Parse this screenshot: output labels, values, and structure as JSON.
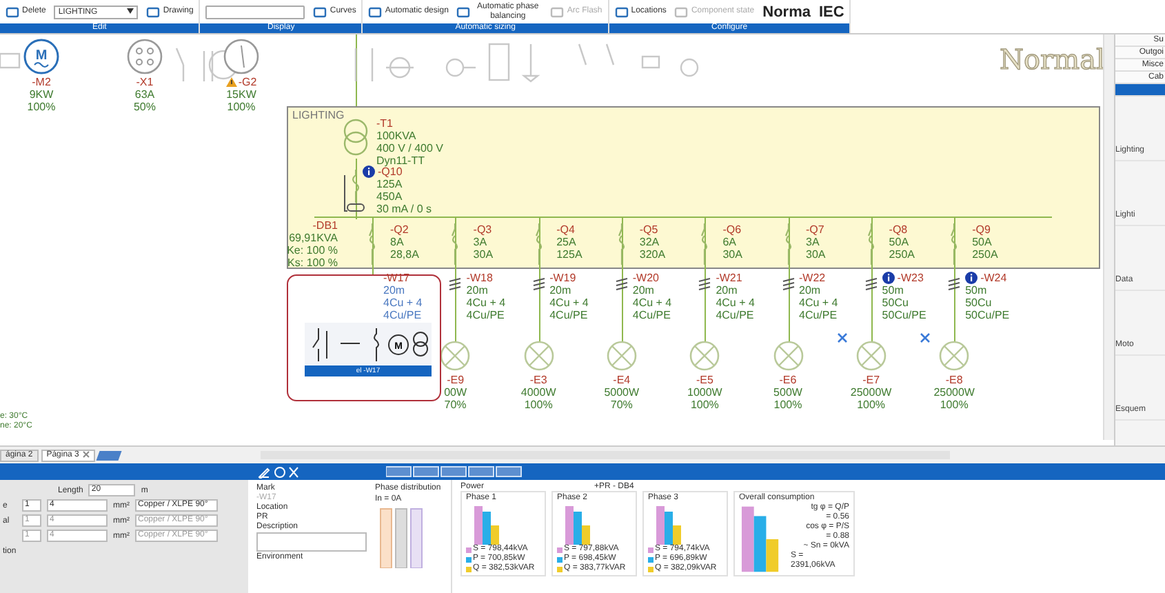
{
  "ribbon": {
    "groups": [
      {
        "label": "Edit",
        "items": [
          {
            "kind": "button",
            "label": "Delete",
            "disabled": false
          },
          {
            "kind": "dropdown",
            "value": "LIGHTING"
          },
          {
            "kind": "button",
            "label": "Drawing",
            "disabled": false
          }
        ]
      },
      {
        "label": "Display",
        "items": [
          {
            "kind": "field"
          },
          {
            "kind": "button",
            "label": "Curves",
            "disabled": false
          }
        ]
      },
      {
        "label": "Automatic sizing",
        "items": [
          {
            "kind": "button",
            "label": "Automatic design",
            "disabled": false
          },
          {
            "kind": "button",
            "label": "Automatic phase balancing",
            "disabled": false
          },
          {
            "kind": "button",
            "label": "Arc Flash",
            "disabled": true
          }
        ]
      },
      {
        "label": "Configure",
        "items": [
          {
            "kind": "button",
            "label": "Locations",
            "disabled": false
          },
          {
            "kind": "button",
            "label": "Component state",
            "disabled": true
          },
          {
            "kind": "big",
            "label": "Norma"
          },
          {
            "kind": "big",
            "label": "IEC"
          }
        ]
      }
    ]
  },
  "mode_label": "Normal",
  "palette": [
    {
      "kind": "motor",
      "letter": "M",
      "mark": "-M2",
      "rating": "9KW",
      "factor": "100%",
      "warning": false
    },
    {
      "kind": "socket",
      "mark": "-X1",
      "rating": "63A",
      "factor": "50%",
      "warning": false
    },
    {
      "kind": "generator",
      "mark": "-G2",
      "rating": "15KW",
      "factor": "100%",
      "warning": true
    }
  ],
  "board": {
    "title": "LIGHTING",
    "transformer": {
      "mark": "-T1",
      "lines": [
        "100KVA",
        "400 V / 400 V",
        "Dyn11-TT"
      ]
    },
    "main_breaker": {
      "mark": "-Q10",
      "info": true,
      "lines": [
        "125A",
        "450A",
        "30 mA / 0 s"
      ]
    },
    "distribution": {
      "mark": "-DB1",
      "lines": [
        "69,91KVA",
        "Ke: 100 %",
        "Ks: 100 %"
      ]
    }
  },
  "feeders": [
    {
      "breaker": "-Q2",
      "b_lines": [
        "8A",
        "28,8A"
      ],
      "cable": "-W17",
      "c_lines": [
        "20m",
        "4Cu + 4",
        "4Cu/PE"
      ],
      "info": false,
      "selected": true
    },
    {
      "breaker": "-Q3",
      "b_lines": [
        "3A",
        "30A"
      ],
      "cable": "-W18",
      "c_lines": [
        "20m",
        "4Cu + 4",
        "4Cu/PE"
      ],
      "info": false,
      "selected": false,
      "load": {
        "mark": "-E9",
        "power": "00W",
        "factor": "70%"
      }
    },
    {
      "breaker": "-Q4",
      "b_lines": [
        "25A",
        "125A"
      ],
      "cable": "-W19",
      "c_lines": [
        "20m",
        "4Cu + 4",
        "4Cu/PE"
      ],
      "info": false,
      "selected": false,
      "load": {
        "mark": "-E3",
        "power": "4000W",
        "factor": "100%"
      }
    },
    {
      "breaker": "-Q5",
      "b_lines": [
        "32A",
        "320A"
      ],
      "cable": "-W20",
      "c_lines": [
        "20m",
        "4Cu + 4",
        "4Cu/PE"
      ],
      "info": false,
      "selected": false,
      "load": {
        "mark": "-E4",
        "power": "5000W",
        "factor": "70%"
      }
    },
    {
      "breaker": "-Q6",
      "b_lines": [
        "6A",
        "30A"
      ],
      "cable": "-W21",
      "c_lines": [
        "20m",
        "4Cu + 4",
        "4Cu/PE"
      ],
      "info": false,
      "selected": false,
      "load": {
        "mark": "-E5",
        "power": "1000W",
        "factor": "100%"
      }
    },
    {
      "breaker": "-Q7",
      "b_lines": [
        "3A",
        "30A"
      ],
      "cable": "-W22",
      "c_lines": [
        "20m",
        "4Cu + 4",
        "4Cu/PE"
      ],
      "info": false,
      "selected": false,
      "load": {
        "mark": "-E6",
        "power": "500W",
        "factor": "100%"
      }
    },
    {
      "breaker": "-Q8",
      "b_lines": [
        "50A",
        "250A"
      ],
      "cable": "-W23",
      "c_lines": [
        "50m",
        "50Cu",
        "50Cu/PE"
      ],
      "info": true,
      "selected": false,
      "load": {
        "mark": "-E7",
        "power": "25000W",
        "factor": "100%"
      }
    },
    {
      "breaker": "-Q9",
      "b_lines": [
        "50A",
        "250A"
      ],
      "cable": "-W24",
      "c_lines": [
        "50m",
        "50Cu",
        "50Cu/PE"
      ],
      "info": true,
      "selected": false,
      "load": {
        "mark": "-E8",
        "power": "25000W",
        "factor": "100%"
      }
    }
  ],
  "selection_popup": {
    "title": "el -W17",
    "motor_letter": "M"
  },
  "ambient": [
    "e: 30°C",
    "ne: 20°C"
  ],
  "page_tabs": [
    {
      "label": "ágina 2",
      "selected": false
    },
    {
      "label": "Página 3",
      "selected": true
    }
  ],
  "side_panel": {
    "tabs": [
      {
        "label": "Su",
        "selected": false
      },
      {
        "label": "Outgoi",
        "selected": false
      },
      {
        "label": "Misce",
        "selected": false
      },
      {
        "label": "Cab",
        "selected": false
      },
      {
        "selected": true
      }
    ],
    "items": [
      "Lighting",
      "Lighti",
      "Data",
      "Moto",
      "Esquem"
    ]
  },
  "cable_form": {
    "length_label": "Length",
    "length": "20",
    "length_unit": "m",
    "rows": [
      {
        "label": "e",
        "count": "1",
        "section": "4",
        "unit": "mm²",
        "material": "Copper / XLPE 90°",
        "disabled": false
      },
      {
        "label": "al",
        "count": "1",
        "section": "4",
        "unit": "mm²",
        "material": "Copper / XLPE 90°",
        "disabled": true
      },
      {
        "label": "",
        "count": "1",
        "section": "4",
        "unit": "mm²",
        "material": "Copper / XLPE 90°",
        "disabled": true
      }
    ],
    "footer": "tion"
  },
  "properties": {
    "mark_label": "Mark",
    "mark": "-W17",
    "location_label": "Location",
    "location": "PR",
    "description_label": "Description",
    "environment_label": "Environment"
  },
  "phase_distribution": {
    "title": "Phase distribution",
    "legend": "In = 0A"
  },
  "power": {
    "title": "Power",
    "subtitle": "+PR - DB4",
    "phases": [
      {
        "title": "Phase 1",
        "lines": [
          "S = 798,44kVA",
          "P = 700,85kW",
          "Q = 382,53kVAR"
        ]
      },
      {
        "title": "Phase 2",
        "lines": [
          "S = 797,88kVA",
          "P = 698,45kW",
          "Q = 383,77kVAR"
        ]
      },
      {
        "title": "Phase 3",
        "lines": [
          "S = 794,74kVA",
          "P = 696,89kW",
          "Q = 382,09kVAR"
        ]
      }
    ]
  },
  "overall": {
    "title": "Overall consumption",
    "lines": [
      "tg φ = Q/P",
      "= 0.56",
      "cos φ = P/S",
      "= 0.88",
      "~ Sn = 0kVA",
      "S = 2391,06kVA"
    ]
  }
}
